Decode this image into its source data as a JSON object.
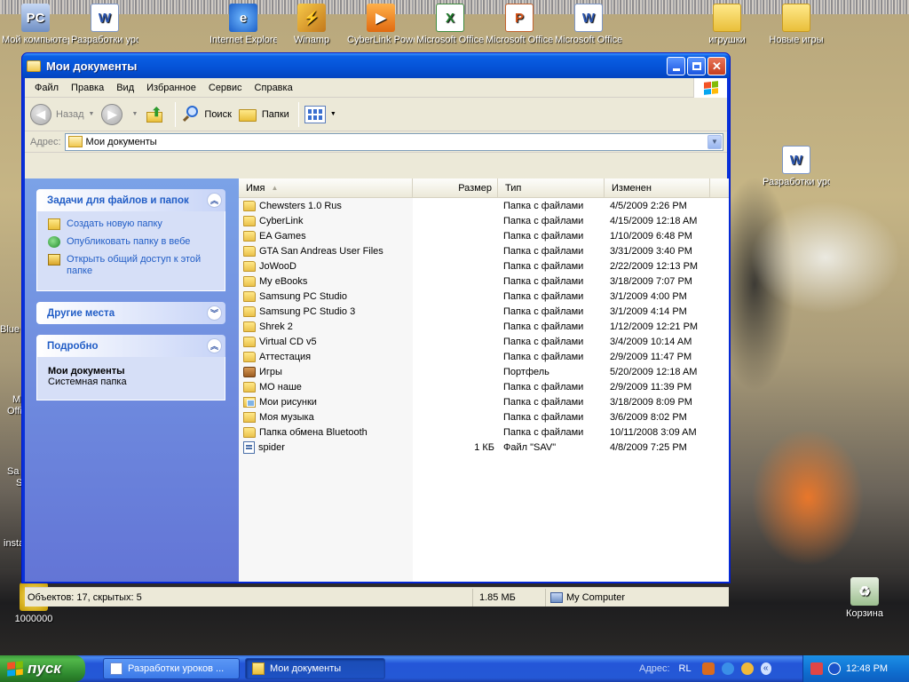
{
  "desktop": {
    "icons": [
      {
        "label": "Мой компьютер",
        "glyph": "PC"
      },
      {
        "label": "Разработки уроков 7...",
        "glyph": "W"
      },
      {
        "label": "Internet Explorer",
        "glyph": "e"
      },
      {
        "label": "Winamp",
        "glyph": "⚡"
      },
      {
        "label": "CyberLink PowerDVD",
        "glyph": "▶"
      },
      {
        "label": "Microsoft Office Ex...",
        "glyph": "X"
      },
      {
        "label": "Microsoft Office P...",
        "glyph": "P"
      },
      {
        "label": "Microsoft Office W...",
        "glyph": "W"
      },
      {
        "label": "игрушки",
        "glyph": ""
      },
      {
        "label": "Новые игры",
        "glyph": ""
      },
      {
        "label": "Разработки уроков 7...",
        "glyph": "W"
      },
      {
        "label": "1000000",
        "glyph": "$"
      },
      {
        "label": "Корзина",
        "glyph": "♻"
      }
    ],
    "left_edge_labels": [
      "Blue",
      "M",
      "Offi",
      "Sa",
      "S",
      "insta"
    ]
  },
  "window": {
    "title": "Мои документы",
    "menu": [
      "Файл",
      "Правка",
      "Вид",
      "Избранное",
      "Сервис",
      "Справка"
    ],
    "toolbar": {
      "back_label": "Назад",
      "search_label": "Поиск",
      "folders_label": "Папки"
    },
    "address": {
      "label": "Адрес:",
      "value": "Мои документы"
    },
    "taskpane": {
      "tasks_title": "Задачи для файлов и папок",
      "tasks": [
        "Создать новую папку",
        "Опубликовать папку в вебе",
        "Открыть общий доступ к этой папке"
      ],
      "other_places_title": "Другие места",
      "details_title": "Подробно",
      "details_name": "Мои документы",
      "details_type": "Системная папка"
    },
    "columns": {
      "name": "Имя",
      "size": "Размер",
      "type": "Тип",
      "modified": "Изменен"
    },
    "files": [
      {
        "name": "Chewsters 1.0 Rus",
        "size": "",
        "type": "Папка с файлами",
        "modified": "4/5/2009 2:26 PM",
        "icon": "folder"
      },
      {
        "name": "CyberLink",
        "size": "",
        "type": "Папка с файлами",
        "modified": "4/15/2009 12:18 AM",
        "icon": "folder"
      },
      {
        "name": "EA Games",
        "size": "",
        "type": "Папка с файлами",
        "modified": "1/10/2009 6:48 PM",
        "icon": "folder"
      },
      {
        "name": "GTA San Andreas User Files",
        "size": "",
        "type": "Папка с файлами",
        "modified": "3/31/2009 3:40 PM",
        "icon": "folder"
      },
      {
        "name": "JoWooD",
        "size": "",
        "type": "Папка с файлами",
        "modified": "2/22/2009 12:13 PM",
        "icon": "folder"
      },
      {
        "name": "My eBooks",
        "size": "",
        "type": "Папка с файлами",
        "modified": "3/18/2009 7:07 PM",
        "icon": "folder"
      },
      {
        "name": "Samsung PC Studio",
        "size": "",
        "type": "Папка с файлами",
        "modified": "3/1/2009 4:00 PM",
        "icon": "folder"
      },
      {
        "name": "Samsung PC Studio 3",
        "size": "",
        "type": "Папка с файлами",
        "modified": "3/1/2009 4:14 PM",
        "icon": "folder"
      },
      {
        "name": "Shrek 2",
        "size": "",
        "type": "Папка с файлами",
        "modified": "1/12/2009 12:21 PM",
        "icon": "folder"
      },
      {
        "name": "Virtual CD v5",
        "size": "",
        "type": "Папка с файлами",
        "modified": "3/4/2009 10:14 AM",
        "icon": "folder"
      },
      {
        "name": "Аттестация",
        "size": "",
        "type": "Папка с файлами",
        "modified": "2/9/2009 11:47 PM",
        "icon": "folder"
      },
      {
        "name": "Игры",
        "size": "",
        "type": "Портфель",
        "modified": "5/20/2009 12:18 AM",
        "icon": "brief"
      },
      {
        "name": "МО наше",
        "size": "",
        "type": "Папка с файлами",
        "modified": "2/9/2009 11:39 PM",
        "icon": "folder"
      },
      {
        "name": "Мои рисунки",
        "size": "",
        "type": "Папка с файлами",
        "modified": "3/18/2009 8:09 PM",
        "icon": "pics"
      },
      {
        "name": "Моя музыка",
        "size": "",
        "type": "Папка с файлами",
        "modified": "3/6/2009 8:02 PM",
        "icon": "music"
      },
      {
        "name": "Папка обмена Bluetooth",
        "size": "",
        "type": "Папка с файлами",
        "modified": "10/11/2008 3:09 AM",
        "icon": "folder"
      },
      {
        "name": "spider",
        "size": "1 КБ",
        "type": "Файл \"SAV\"",
        "modified": "4/8/2009 7:25 PM",
        "icon": "file"
      }
    ],
    "status": {
      "objects": "Объектов: 17, скрытых: 5",
      "size": "1.85 МБ",
      "location": "My Computer"
    }
  },
  "taskbar": {
    "start_label": "пуск",
    "tasks": [
      "Разработки уроков ...",
      "Мои документы"
    ],
    "address_label": "Адрес:",
    "language": "RL",
    "clock": "12:48 PM"
  }
}
